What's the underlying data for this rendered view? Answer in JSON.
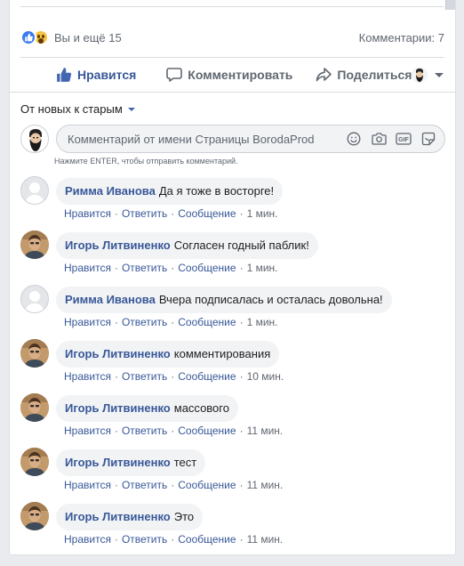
{
  "reactions": {
    "summary": "Вы и ещё 15",
    "comments_count": "Комментарии: 7"
  },
  "actions": {
    "like": "Нравится",
    "comment": "Комментировать",
    "share": "Поделиться"
  },
  "sort": {
    "label": "От новых к старым"
  },
  "composer": {
    "placeholder": "Комментарий от имени Страницы BorodaProd",
    "hint": "Нажмите ENTER, чтобы отправить комментарий."
  },
  "meta_labels": {
    "like": "Нравится",
    "reply": "Ответить",
    "message": "Сообщение"
  },
  "comments": [
    {
      "author": "Римма Иванова",
      "text": "Да я тоже в восторге!",
      "time": "1 мин.",
      "avatar": "blank"
    },
    {
      "author": "Игорь Литвиненко",
      "text": "Согласен годный паблик!",
      "time": "1 мин.",
      "avatar": "photo"
    },
    {
      "author": "Римма Иванова",
      "text": "Вчера подписалась и осталась довольна!",
      "time": "1 мин.",
      "avatar": "blank"
    },
    {
      "author": "Игорь Литвиненко",
      "text": "комментирования",
      "time": "10 мин.",
      "avatar": "photo"
    },
    {
      "author": "Игорь Литвиненко",
      "text": "массового",
      "time": "11 мин.",
      "avatar": "photo"
    },
    {
      "author": "Игорь Литвиненко",
      "text": "тест",
      "time": "11 мин.",
      "avatar": "photo"
    },
    {
      "author": "Игорь Литвиненко",
      "text": "Это",
      "time": "11 мин.",
      "avatar": "photo"
    }
  ],
  "colors": {
    "link": "#385898",
    "like_blue": "#3b7bf0",
    "bubble_bg": "#f2f3f5",
    "meta_gray": "#606770"
  },
  "icons": [
    "like-reaction-icon",
    "wow-reaction-icon",
    "thumbs-up-icon",
    "comment-icon",
    "share-icon",
    "chevron-down-icon",
    "emoji-icon",
    "camera-icon",
    "gif-icon",
    "sticker-icon"
  ]
}
